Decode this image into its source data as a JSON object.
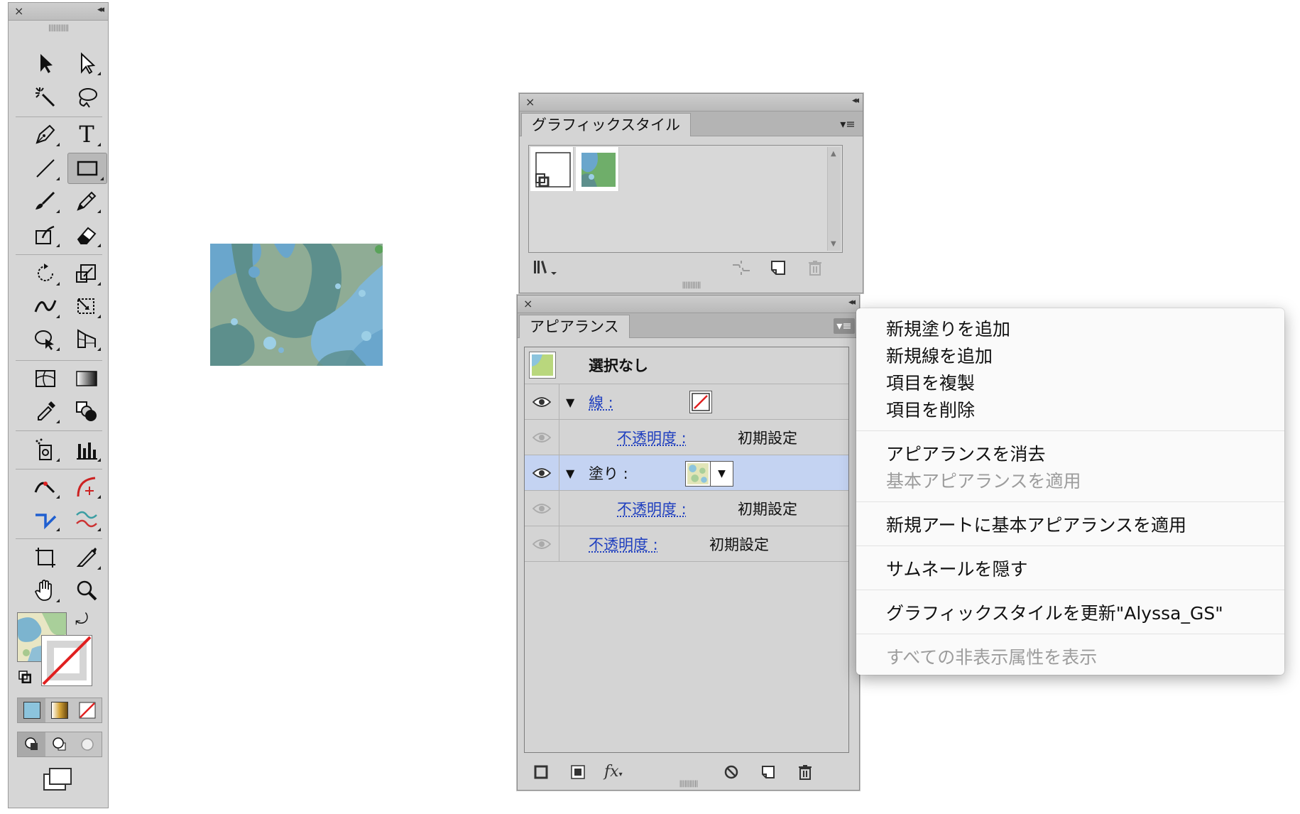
{
  "graphic_styles_panel": {
    "tab_label": "グラフィックスタイル",
    "swatch_names": [
      "default-graphic-style",
      "pattern-graphic-style"
    ]
  },
  "appearance_panel": {
    "tab_label": "アピアランス",
    "header_title": "選択なし",
    "rows": {
      "stroke_label": "線 :",
      "stroke_opacity_label": "不透明度 :",
      "stroke_opacity_value": "初期設定",
      "fill_label": "塗り :",
      "fill_opacity_label": "不透明度 :",
      "fill_opacity_value": "初期設定",
      "opacity_label": "不透明度 :",
      "opacity_value": "初期設定"
    },
    "footer_fx_label": "fx"
  },
  "context_menu": {
    "add_fill": "新規塗りを追加",
    "add_stroke": "新規線を追加",
    "duplicate_item": "項目を複製",
    "remove_item": "項目を削除",
    "clear_appearance": "アピアランスを消去",
    "reduce_to_basic": "基本アピアランスを適用",
    "new_art_basic": "新規アートに基本アピアランスを適用",
    "hide_thumbnails": "サムネールを隠す",
    "redefine_style": "グラフィックスタイルを更新\"Alyssa_GS\"",
    "show_hidden": "すべての非表示属性を表示"
  },
  "colors": {
    "selected_row": "#c4d3f2",
    "link_text": "#1f3fbf",
    "disabled_text": "#9c9c9c",
    "none_red": "#e02020",
    "pattern_green": "#8fac95",
    "pattern_blue": "#6aa6cc",
    "pattern_teal": "#5d8f8c"
  },
  "tools": {
    "type_tool_glyph": "T"
  }
}
